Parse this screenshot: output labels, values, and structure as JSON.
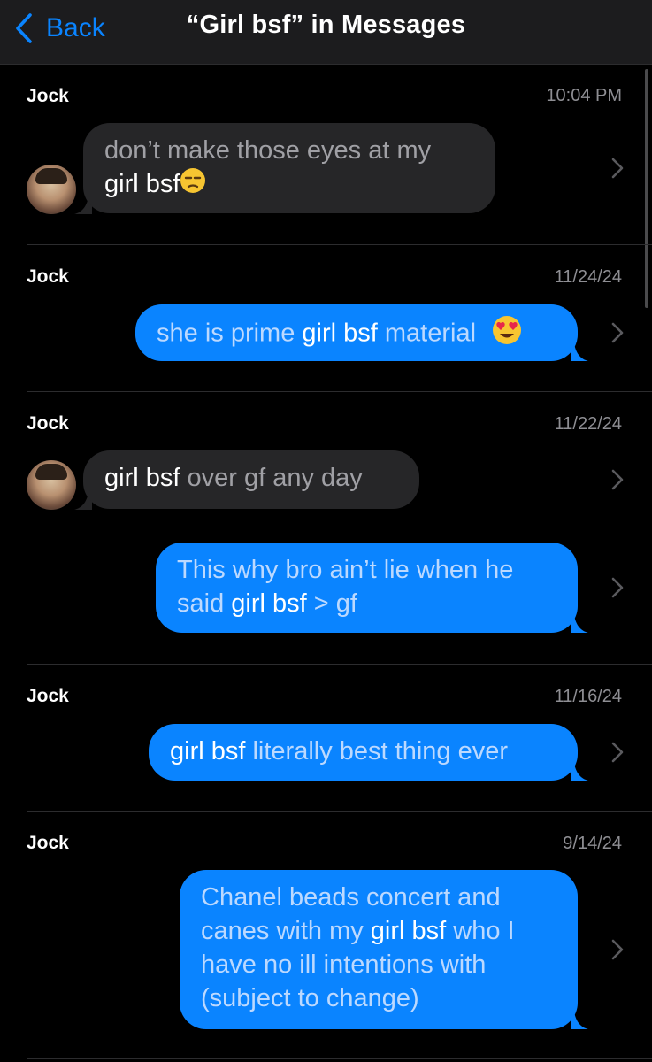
{
  "header": {
    "back_label": "Back",
    "title": "“Girl bsf” in Messages"
  },
  "results": [
    {
      "sender": "Jock",
      "date": "10:04 PM",
      "messages": [
        {
          "dir": "in",
          "line1_pre": "don’t make those eyes at my",
          "line2_hl": "girl bsf",
          "emoji": "unamused-face"
        }
      ]
    },
    {
      "sender": "Jock",
      "date": "11/24/24",
      "messages": [
        {
          "dir": "out",
          "pre": "she is prime ",
          "hl": "girl bsf",
          "post": " material",
          "emoji": "heart-eyes-face"
        }
      ]
    },
    {
      "sender": "Jock",
      "date": "11/22/24",
      "messages": [
        {
          "dir": "in",
          "hl": "girl bsf",
          "post": " over gf any day"
        },
        {
          "dir": "out",
          "line1": "This why bro ain’t lie when he",
          "line2_pre": "said ",
          "line2_hl": "girl bsf",
          "line2_post": " > gf"
        }
      ]
    },
    {
      "sender": "Jock",
      "date": "11/16/24",
      "messages": [
        {
          "dir": "out",
          "hl": "girl bsf",
          "post": " literally best thing ever"
        }
      ]
    },
    {
      "sender": "Jock",
      "date": "9/14/24",
      "messages": [
        {
          "dir": "out",
          "line1": "Chanel beads concert and",
          "line2_pre": "canes with my ",
          "line2_hl": "girl bsf",
          "line2_post": " who I",
          "line3": "have no ill intentions with",
          "line4": "(subject to change)"
        }
      ]
    }
  ],
  "colors": {
    "accent": "#0a84ff",
    "incoming_bubble": "#262628",
    "background": "#000000",
    "secondary_text": "#8e8e93"
  }
}
